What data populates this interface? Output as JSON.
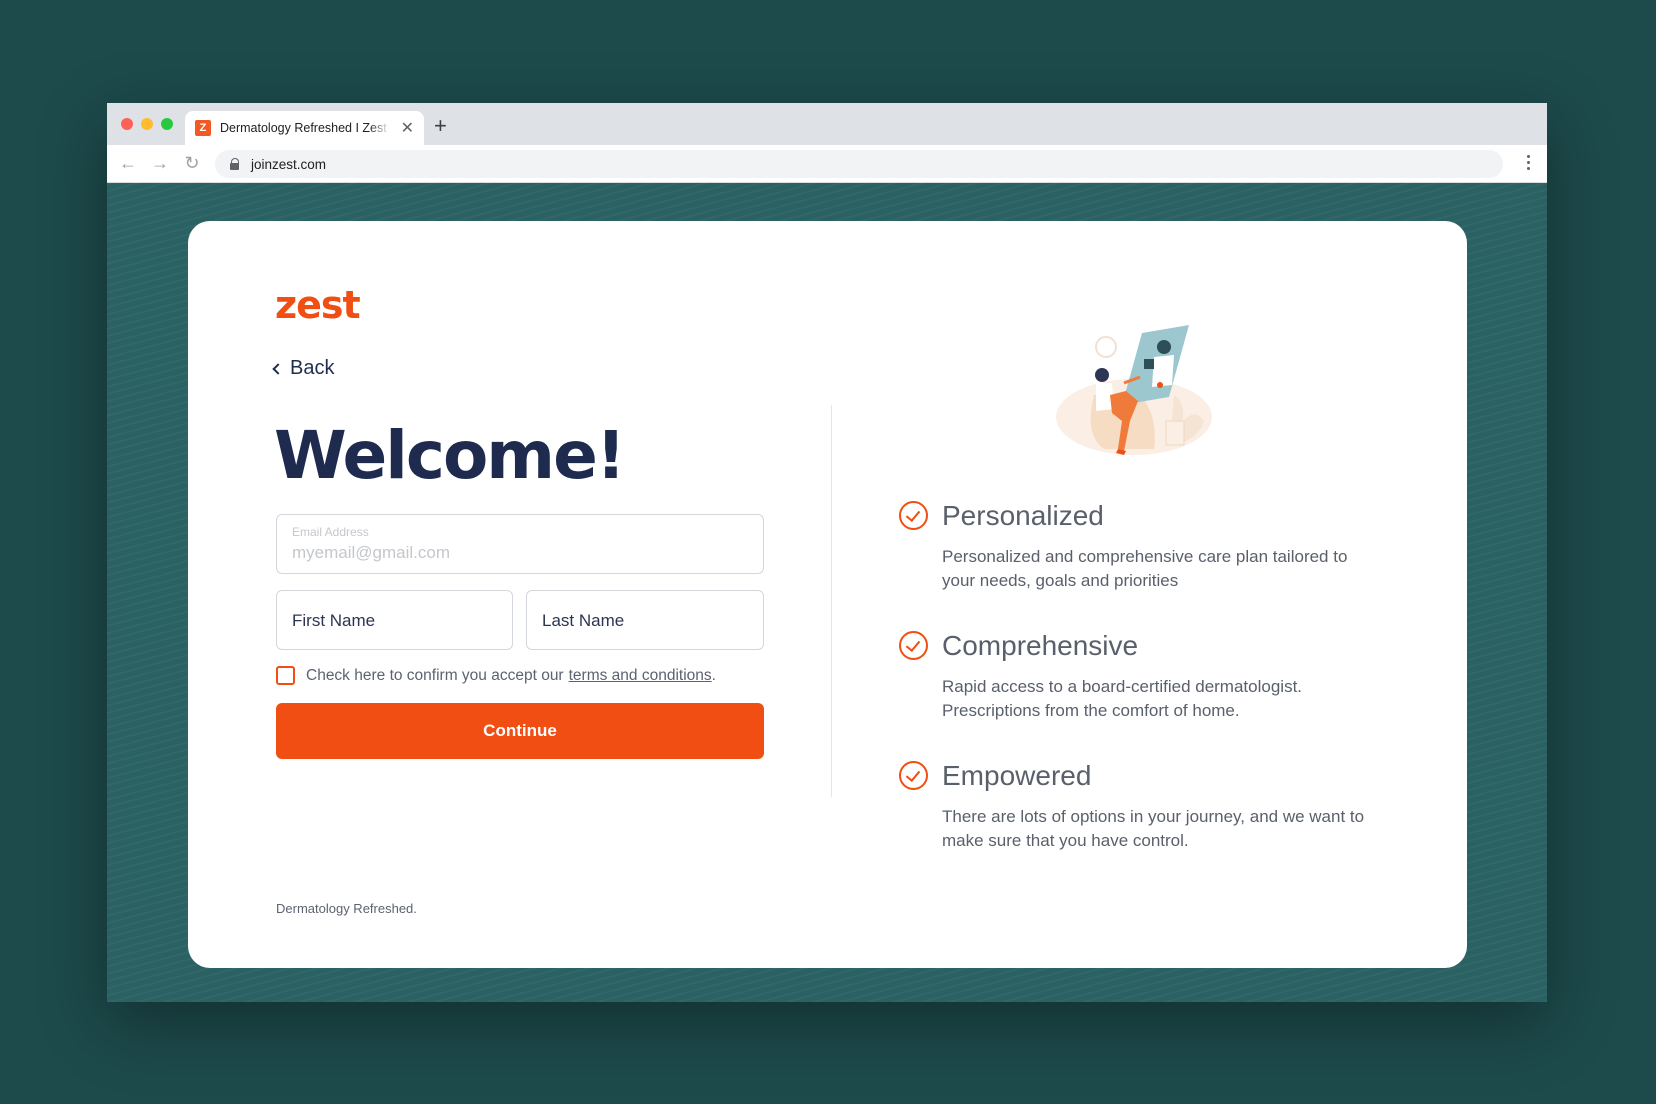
{
  "browser": {
    "tab_title": "Dermatology Refreshed I Zest",
    "tab_favicon": "Z",
    "url": "joinzest.com",
    "icons": [
      "close-icon",
      "plus-icon",
      "back-arrow-icon",
      "forward-arrow-icon",
      "reload-icon",
      "lock-icon",
      "kebab-menu-icon"
    ]
  },
  "form": {
    "logo": "zest",
    "back_label": "Back",
    "heading": "Welcome!",
    "email_label": "Email Address",
    "email_placeholder": "myemail@gmail.com",
    "first_name_placeholder": "First Name",
    "last_name_placeholder": "Last Name",
    "terms_text": "Check here to confirm you accept our",
    "terms_link": "terms and conditions",
    "terms_period": ".",
    "continue_label": "Continue",
    "footer": "Dermatology Refreshed."
  },
  "features": [
    {
      "title": "Personalized",
      "description": "Personalized and comprehensive care plan tailored to your needs, goals and priorities"
    },
    {
      "title": "Comprehensive",
      "description": "Rapid access to a board-certified dermatologist. Prescriptions from the comfort of home."
    },
    {
      "title": "Empowered",
      "description": "There are lots of options in your journey, and we want to make sure that you have control."
    }
  ],
  "colors": {
    "brand": "#f04e12",
    "heading": "#1e2b4e",
    "backdrop": "#1d4a4b",
    "page_bg": "#2a6163"
  }
}
